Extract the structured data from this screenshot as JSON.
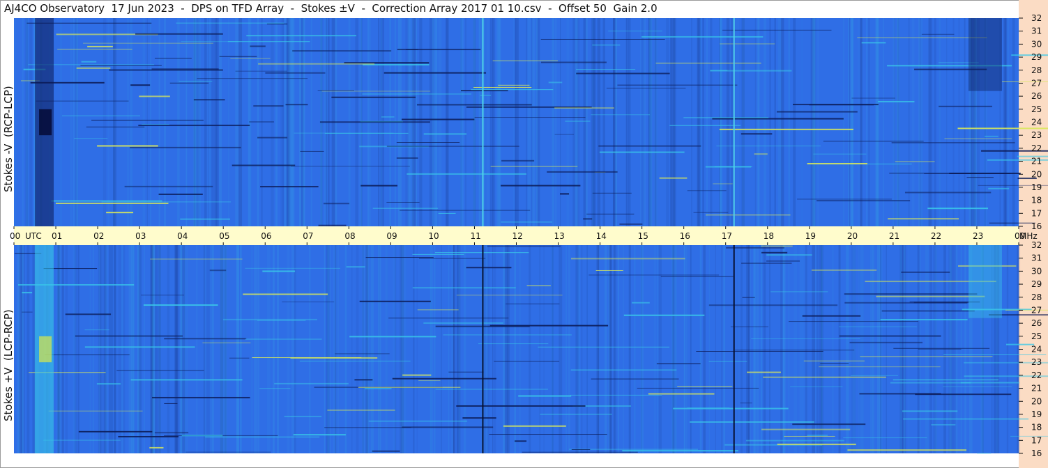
{
  "title": "AJ4CO Observatory  17 Jun 2023  -  DPS on TFD Array  -  Stokes ±V  -  Correction Array 2017 01 10.csv  -  Offset 50  Gain 2.0",
  "colors": {
    "background": "#ffffff",
    "axis_strip": "#fffccc",
    "right_strip": "#fbdcc4",
    "spectrogram_base": "#2f6ee6",
    "spectrogram_dark": "#0b1a55",
    "spectrogram_bright": "#39c7e8"
  },
  "chart_data": [
    {
      "type": "heatmap",
      "panel": "top",
      "ylabel": "Stokes -V  (RCP-LCP)",
      "y_unit": "MHz",
      "y_ticks": [
        "32",
        "31",
        "30",
        "29",
        "28",
        "27",
        "26",
        "25",
        "24",
        "23",
        "22",
        "21",
        "20",
        "19",
        "18",
        "17",
        "16"
      ],
      "ylim": [
        16,
        32
      ],
      "xlim": [
        0,
        24
      ],
      "x_ticks": [
        "00",
        "01",
        "02",
        "03",
        "04",
        "05",
        "06",
        "07",
        "08",
        "09",
        "10",
        "11",
        "12",
        "13",
        "14",
        "15",
        "16",
        "17",
        "18",
        "19",
        "20",
        "21",
        "22",
        "23",
        "00"
      ],
      "x_unit": "UTC",
      "vertical_markers_utc": [
        11.2,
        17.2
      ]
    },
    {
      "type": "heatmap",
      "panel": "bottom",
      "ylabel": "Stokes +V  (LCP-RCP)",
      "y_unit": "MHz",
      "y_ticks": [
        "32",
        "31",
        "30",
        "29",
        "28",
        "27",
        "26",
        "25",
        "24",
        "23",
        "22",
        "21",
        "20",
        "19",
        "18",
        "17",
        "16"
      ],
      "ylim": [
        16,
        32
      ],
      "xlim": [
        0,
        24
      ],
      "x_ticks": [
        "00",
        "01",
        "02",
        "03",
        "04",
        "05",
        "06",
        "07",
        "08",
        "09",
        "10",
        "11",
        "12",
        "13",
        "14",
        "15",
        "16",
        "17",
        "18",
        "19",
        "20",
        "21",
        "22",
        "23",
        "00"
      ],
      "x_unit": "UTC",
      "vertical_markers_utc": [
        11.2,
        17.2
      ]
    }
  ],
  "axis": {
    "utc_label": "UTC",
    "mhz_label": "MHz"
  }
}
